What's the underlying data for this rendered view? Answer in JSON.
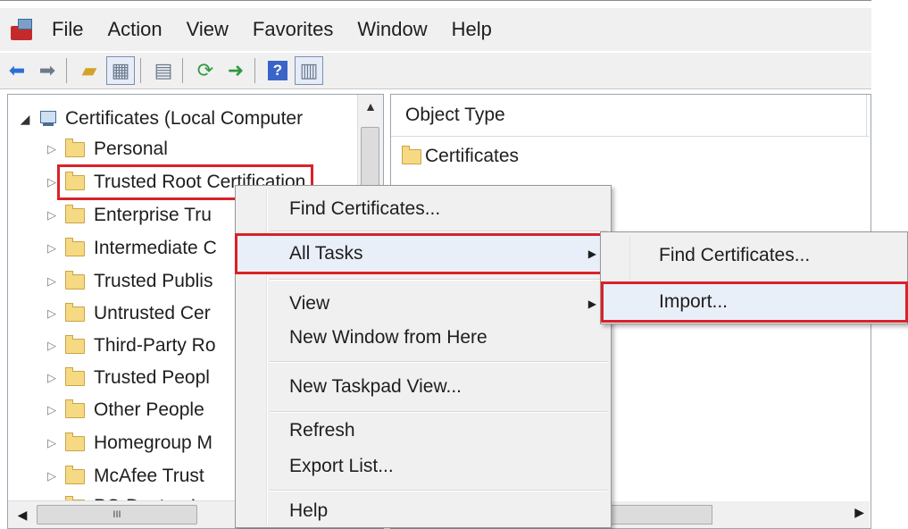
{
  "menubar": {
    "items": [
      "File",
      "Action",
      "View",
      "Favorites",
      "Window",
      "Help"
    ]
  },
  "toolbar": {
    "icons": [
      "back-icon",
      "forward-icon",
      "up-folder-icon",
      "show-hide-tree-icon",
      "properties-icon",
      "refresh-icon",
      "export-icon",
      "help-icon",
      "action-pane-icon"
    ]
  },
  "tree": {
    "root": "Certificates (Local Computer",
    "items": [
      "Personal",
      "Trusted Root Certification",
      "Enterprise Tru",
      "Intermediate C",
      "Trusted Publis",
      "Untrusted Cer",
      "Third-Party Ro",
      "Trusted Peopl",
      "Other People",
      "Homegroup M",
      "McAfee Trust",
      "PC-Doctor, In"
    ],
    "scroll_left_thumb_glyph": "III"
  },
  "right_pane": {
    "column_header": "Object Type",
    "rows": [
      "Certificates"
    ]
  },
  "context_menu": {
    "items": [
      "Find Certificates...",
      "All Tasks",
      "View",
      "New Window from Here",
      "New Taskpad View...",
      "Refresh",
      "Export List...",
      "Help"
    ]
  },
  "submenu": {
    "items": [
      "Find Certificates...",
      "Import..."
    ]
  },
  "colors": {
    "highlight_outline": "#d9222a",
    "menu_bg": "#f0f0f0",
    "folder": "#f6d983"
  }
}
